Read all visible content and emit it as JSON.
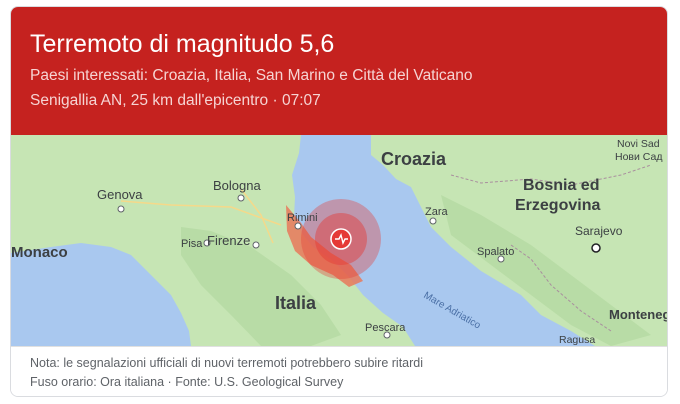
{
  "header": {
    "title": "Terremoto di magnitudo 5,6",
    "countries": "Paesi interessati: Croazia, Italia, San Marino e Città del Vaticano",
    "location": "Senigallia AN, 25 km dall'epicentro · 07:07"
  },
  "map": {
    "labels": {
      "croazia": "Croazia",
      "bosnia_1": "Bosnia ed",
      "bosnia_2": "Erzegovina",
      "genova": "Genova",
      "bologna": "Bologna",
      "monaco": "Monaco",
      "rimini": "Rimini",
      "pisa": "Pisa",
      "firenze": "Firenze",
      "italia": "Italia",
      "pescara": "Pescara",
      "zara": "Zara",
      "spalato": "Spalato",
      "sarajevo": "Sarajevo",
      "novi_sad": "Novi Sad",
      "novi_sad_cyr": "Нови Сад",
      "montenegro": "Monteneg",
      "mare_adriatico": "Mare Adriatico",
      "ragusa": "Ragusa"
    },
    "colors": {
      "sea": "#a9c8ef",
      "land": "#c6e5b4",
      "alert": "#e53935"
    }
  },
  "footer": {
    "note": "Nota: le segnalazioni ufficiali di nuovi terremoti potrebbero subire ritardi",
    "meta": "Fuso orario: Ora italiana · Fonte: U.S. Geological Survey"
  }
}
